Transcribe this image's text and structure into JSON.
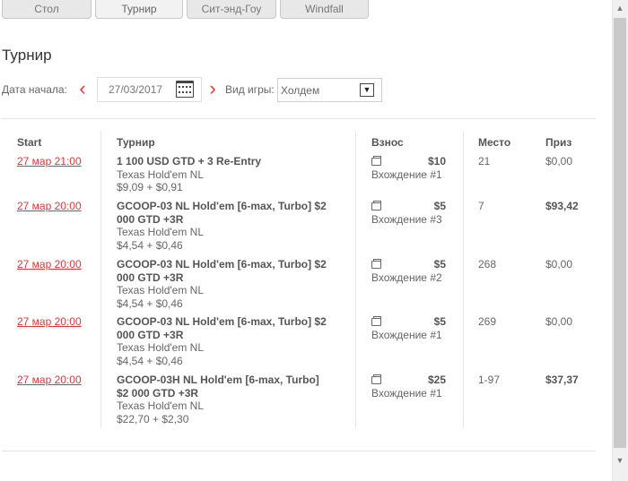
{
  "tabs": [
    {
      "label": "Стол",
      "active": false
    },
    {
      "label": "Турнир",
      "active": true
    },
    {
      "label": "Сит-энд-Гоу",
      "active": false
    },
    {
      "label": "Windfall",
      "active": false
    }
  ],
  "page": {
    "title": "Турнир"
  },
  "filters": {
    "start_date_label": "Дата начала:",
    "start_date_value": "27/03/2017",
    "game_type_label": "Вид игры:",
    "game_type_value": "Холдем"
  },
  "table": {
    "headers": {
      "start": "Start",
      "tournament": "Турнир",
      "fee": "Взнос",
      "place": "Место",
      "prize": "Приз"
    },
    "rows": [
      {
        "start": "27 мар 21:00",
        "name_line1": "1 100 USD GTD + 3 Re-Entry",
        "name_line2": "",
        "game": "Texas Hold'em NL",
        "buyin": "$9,09 + $0,91",
        "fee": "$10",
        "entry": "Вхождение #1",
        "place": "21",
        "prize": "$0,00",
        "prize_bold": false
      },
      {
        "start": "27 мар 20:00",
        "name_line1": "GCOOP-03 NL Hold'em [6-max, Turbo] $2",
        "name_line2": "000 GTD +3R",
        "game": "Texas Hold'em NL",
        "buyin": "$4,54 + $0,46",
        "fee": "$5",
        "entry": "Вхождение #3",
        "place": "7",
        "prize": "$93,42",
        "prize_bold": true
      },
      {
        "start": "27 мар 20:00",
        "name_line1": "GCOOP-03 NL Hold'em [6-max, Turbo] $2",
        "name_line2": "000 GTD +3R",
        "game": "Texas Hold'em NL",
        "buyin": "$4,54 + $0,46",
        "fee": "$5",
        "entry": "Вхождение #2",
        "place": "268",
        "prize": "$0,00",
        "prize_bold": false
      },
      {
        "start": "27 мар 20:00",
        "name_line1": "GCOOP-03 NL Hold'em [6-max, Turbo] $2",
        "name_line2": "000 GTD +3R",
        "game": "Texas Hold'em NL",
        "buyin": "$4,54 + $0,46",
        "fee": "$5",
        "entry": "Вхождение #1",
        "place": "269",
        "prize": "$0,00",
        "prize_bold": false
      },
      {
        "start": "27 мар 20:00",
        "name_line1": "GCOOP-03H NL Hold'em [6-max, Turbo]",
        "name_line2": "$2 000 GTD +3R",
        "game": "Texas Hold'em NL",
        "buyin": "$22,70 + $2,30",
        "fee": "$25",
        "entry": "Вхождение #1",
        "place": "1-97",
        "prize": "$37,37",
        "prize_bold": true
      }
    ]
  },
  "icons": {
    "prev": "chevron-left-icon",
    "next": "chevron-right-icon",
    "calendar": "calendar-icon",
    "dropdown": "chevron-down-icon",
    "ticket": "ticket-icon"
  },
  "colors": {
    "accent": "#d7393b",
    "text": "#666666",
    "header": "#555555"
  }
}
